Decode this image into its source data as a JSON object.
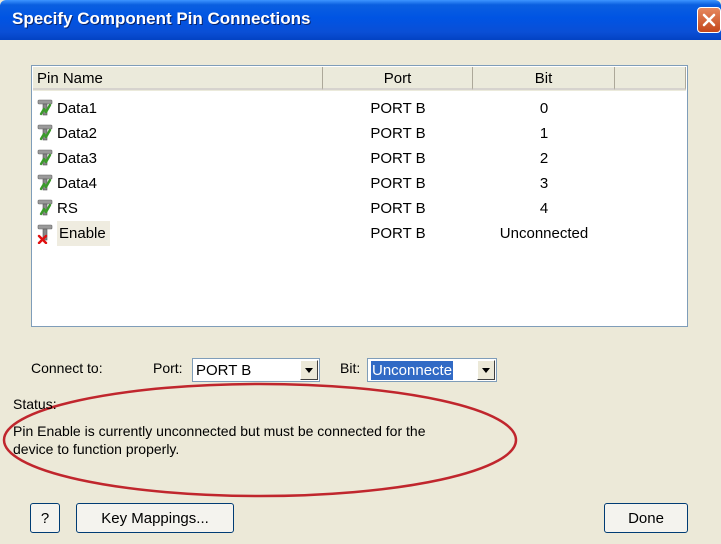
{
  "window": {
    "title": "Specify Component Pin Connections"
  },
  "table": {
    "columns": [
      "Pin Name",
      "Port",
      "Bit"
    ],
    "rows": [
      {
        "name": "Data1",
        "port": "PORT B",
        "bit": "0",
        "connected": true
      },
      {
        "name": "Data2",
        "port": "PORT B",
        "bit": "1",
        "connected": true
      },
      {
        "name": "Data3",
        "port": "PORT B",
        "bit": "2",
        "connected": true
      },
      {
        "name": "Data4",
        "port": "PORT B",
        "bit": "3",
        "connected": true
      },
      {
        "name": "RS",
        "port": "PORT B",
        "bit": "4",
        "connected": true
      },
      {
        "name": "Enable",
        "port": "PORT B",
        "bit": "Unconnected",
        "connected": false
      }
    ]
  },
  "connect": {
    "label": "Connect to:",
    "port_label": "Port:",
    "port_value": "PORT B",
    "bit_label": "Bit:",
    "bit_value": "Unconnecte"
  },
  "status": {
    "label": "Status:",
    "line1": "Pin Enable is currently unconnected but must be connected for the",
    "line2": "device to function properly."
  },
  "buttons": {
    "help": "?",
    "key_mappings": "Key Mappings...",
    "done": "Done"
  },
  "colors": {
    "title_bar": "#0054e3",
    "dialog_bg": "#ece9d8",
    "selection": "#316ac5",
    "highlight_ellipse": "#c0262d",
    "pin_connected": "#3a9a2a",
    "pin_unconnected": "#e01010"
  }
}
